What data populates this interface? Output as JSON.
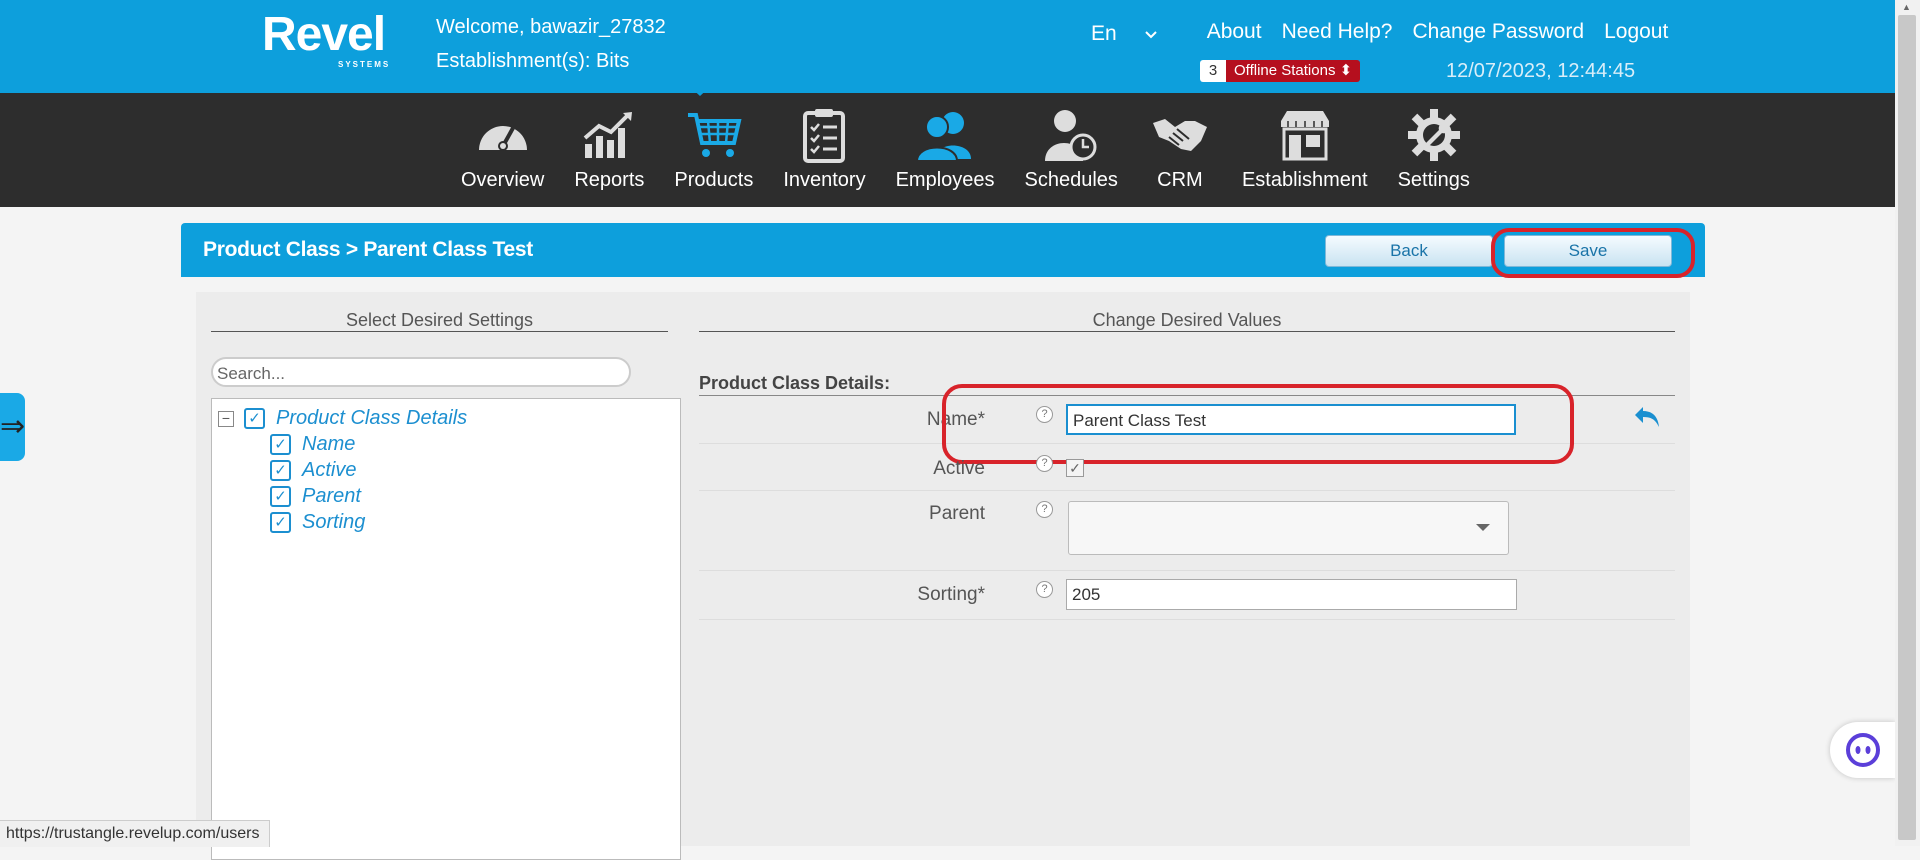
{
  "header": {
    "logo": "Revel",
    "logo_sub": "SYSTEMS",
    "welcome": "Welcome, bawazir_27832",
    "establishment": "Establishment(s): Bits",
    "language": "En",
    "links": [
      "About",
      "Need Help?",
      "Change Password",
      "Logout"
    ],
    "station_count": "3",
    "offline_label": "Offline Stations",
    "datetime": "12/07/2023, 12:44:45"
  },
  "nav": {
    "items": [
      {
        "label": "Overview",
        "icon": "speedometer-icon"
      },
      {
        "label": "Reports",
        "icon": "chart-icon"
      },
      {
        "label": "Products",
        "icon": "cart-icon",
        "active": true
      },
      {
        "label": "Inventory",
        "icon": "clipboard-icon"
      },
      {
        "label": "Employees",
        "icon": "people-icon"
      },
      {
        "label": "Schedules",
        "icon": "person-clock-icon"
      },
      {
        "label": "CRM",
        "icon": "handshake-icon"
      },
      {
        "label": "Establishment",
        "icon": "storefront-icon"
      },
      {
        "label": "Settings",
        "icon": "gear-wrench-icon"
      }
    ]
  },
  "card": {
    "breadcrumb": "Product Class > Parent Class Test",
    "back_label": "Back",
    "save_label": "Save"
  },
  "left": {
    "title": "Select Desired Settings",
    "search_placeholder": "Search...",
    "tree": {
      "root": "Product Class Details",
      "children": [
        "Name",
        "Active",
        "Parent",
        "Sorting"
      ]
    }
  },
  "right": {
    "title": "Change Desired Values",
    "section": "Product Class Details:",
    "fields": {
      "name_label": "Name*",
      "name_value": "Parent Class Test",
      "active_label": "Active",
      "active_checked": true,
      "parent_label": "Parent",
      "parent_value": "",
      "sorting_label": "Sorting*",
      "sorting_value": "205"
    }
  },
  "status_url": "https://trustangle.revelup.com/users",
  "colors": {
    "brand_blue": "#0d9fdc",
    "nav_dark": "#2d2d2d",
    "offline_red": "#b50f1e",
    "highlight_red": "#d8232a"
  }
}
